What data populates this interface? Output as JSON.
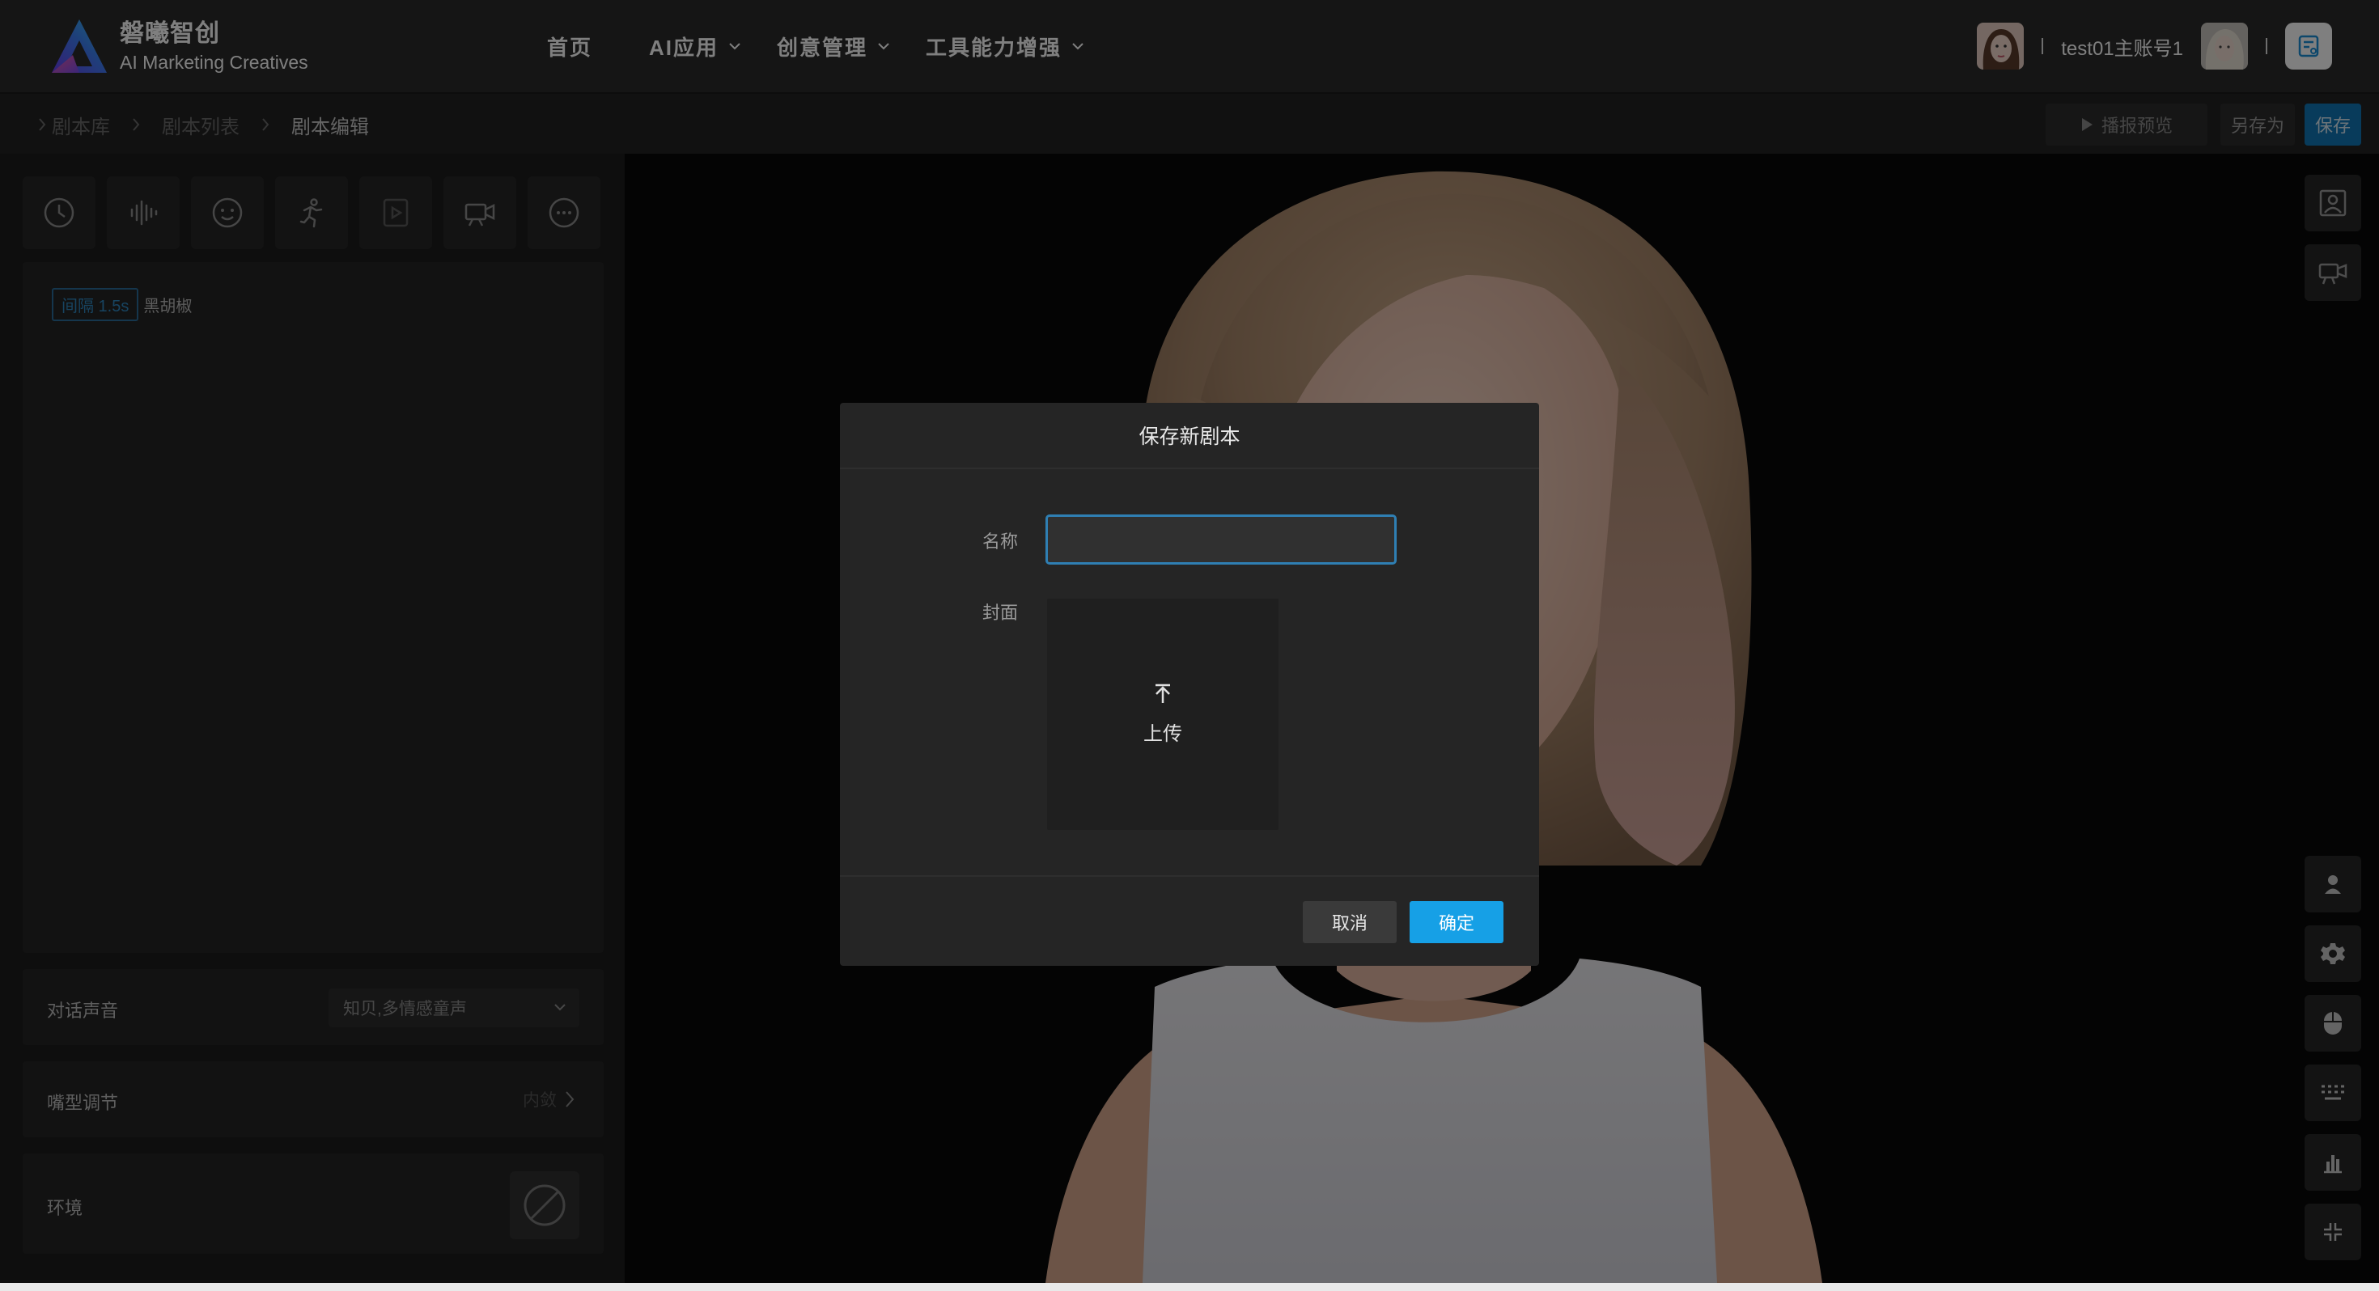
{
  "brand": {
    "name": "磐曦智创",
    "subtitle": "AI Marketing Creatives"
  },
  "nav": {
    "items": [
      {
        "label": "首页",
        "has_dropdown": false
      },
      {
        "label": "AI应用",
        "has_dropdown": true
      },
      {
        "label": "创意管理",
        "has_dropdown": true
      },
      {
        "label": "工具能力增强",
        "has_dropdown": true
      }
    ]
  },
  "user": {
    "name": "test01主账号1",
    "separator": "|"
  },
  "breadcrumb": {
    "items": [
      "剧本库",
      "剧本列表",
      "剧本编辑"
    ]
  },
  "actions": {
    "preview": "播报预览",
    "save_as": "另存为",
    "save": "保存"
  },
  "toolbar": {
    "tools": [
      "clock-icon",
      "audio-wave-icon",
      "smile-icon",
      "motion-icon",
      "video-play-icon",
      "camera-icon",
      "more-icon"
    ]
  },
  "script": {
    "tag": "间隔 1.5s",
    "text": "黑胡椒"
  },
  "settings": {
    "voice_label": "对话声音",
    "voice_value": "知贝,多情感童声",
    "mouth_label": "嘴型调节",
    "mouth_value": "内敛",
    "env_label": "环境"
  },
  "stage_side_buttons": {
    "top": [
      "portrait-icon",
      "camera-icon"
    ],
    "bottom": [
      "person-icon",
      "settings-icon",
      "mouse-icon",
      "keyboard-icon",
      "bar-chart-icon",
      "collapse-icon"
    ]
  },
  "modal": {
    "title": "保存新剧本",
    "name_label": "名称",
    "name_value": "",
    "cover_label": "封面",
    "upload_label": "上传",
    "cancel": "取消",
    "confirm": "确定"
  },
  "colors": {
    "accent": "#16a0e6",
    "save_button": "#1177b7",
    "tag": "#2f88c2"
  }
}
